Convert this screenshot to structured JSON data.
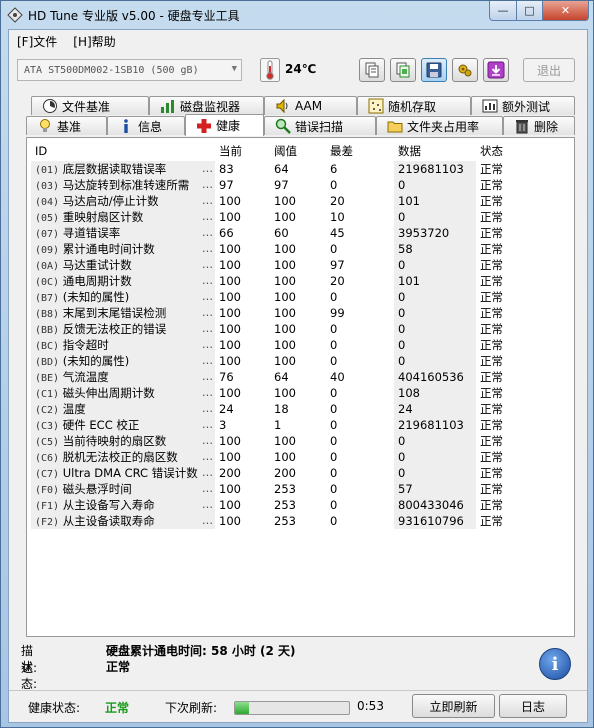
{
  "window": {
    "title": "HD Tune 专业版 v5.00 - 硬盘专业工具",
    "min_label": "—",
    "max_label": "□",
    "close_label": "✕"
  },
  "menu": [
    {
      "label": "[F]文件"
    },
    {
      "label": "[H]帮助"
    }
  ],
  "toolbar": {
    "drive": "ATA    ST500DM002-1SB10 (500 gB)",
    "temperature": "24℃",
    "exit_label": "退出",
    "icons": [
      "copy-info-icon",
      "copy-screen-icon",
      "save-icon",
      "options-icon",
      "download-icon"
    ]
  },
  "tabs_top": [
    {
      "label": "文件基准",
      "icon": "file-benchmark-icon"
    },
    {
      "label": "磁盘监视器",
      "icon": "disk-monitor-icon"
    },
    {
      "label": "AAM",
      "icon": "speaker-icon"
    },
    {
      "label": "随机存取",
      "icon": "random-access-icon"
    },
    {
      "label": "额外测试",
      "icon": "extra-tests-icon"
    }
  ],
  "tabs_bottom": [
    {
      "label": "基准",
      "icon": "benchmark-icon"
    },
    {
      "label": "信息",
      "icon": "info-icon"
    },
    {
      "label": "健康",
      "icon": "health-cross-icon",
      "selected": true
    },
    {
      "label": "错误扫描",
      "icon": "magnifier-icon"
    },
    {
      "label": "文件夹占用率",
      "icon": "folder-icon"
    },
    {
      "label": "删除",
      "icon": "trash-icon"
    }
  ],
  "health_table": {
    "columns": [
      "ID",
      "当前",
      "阈值",
      "最差",
      "数据",
      "状态"
    ],
    "rows": [
      {
        "code": "(01)",
        "name": "底层数据读取错误率",
        "cur": "83",
        "thr": "64",
        "worst": "6",
        "data": "219681103",
        "status": "正常"
      },
      {
        "code": "(03)",
        "name": "马达旋转到标准转速所需",
        "cur": "97",
        "thr": "97",
        "worst": "0",
        "data": "0",
        "status": "正常"
      },
      {
        "code": "(04)",
        "name": "马达启动/停止计数",
        "cur": "100",
        "thr": "100",
        "worst": "20",
        "data": "101",
        "status": "正常"
      },
      {
        "code": "(05)",
        "name": "重映射扇区计数",
        "cur": "100",
        "thr": "100",
        "worst": "10",
        "data": "0",
        "status": "正常"
      },
      {
        "code": "(07)",
        "name": "寻道错误率",
        "cur": "66",
        "thr": "60",
        "worst": "45",
        "data": "3953720",
        "status": "正常"
      },
      {
        "code": "(09)",
        "name": "累计通电时间计数",
        "cur": "100",
        "thr": "100",
        "worst": "0",
        "data": "58",
        "status": "正常"
      },
      {
        "code": "(0A)",
        "name": "马达重试计数",
        "cur": "100",
        "thr": "100",
        "worst": "97",
        "data": "0",
        "status": "正常"
      },
      {
        "code": "(0C)",
        "name": "通电周期计数",
        "cur": "100",
        "thr": "100",
        "worst": "20",
        "data": "101",
        "status": "正常"
      },
      {
        "code": "(B7)",
        "name": "(未知的属性)",
        "cur": "100",
        "thr": "100",
        "worst": "0",
        "data": "0",
        "status": "正常"
      },
      {
        "code": "(B8)",
        "name": "末尾到末尾错误检测",
        "cur": "100",
        "thr": "100",
        "worst": "99",
        "data": "0",
        "status": "正常"
      },
      {
        "code": "(BB)",
        "name": "反馈无法校正的错误",
        "cur": "100",
        "thr": "100",
        "worst": "0",
        "data": "0",
        "status": "正常"
      },
      {
        "code": "(BC)",
        "name": "指令超时",
        "cur": "100",
        "thr": "100",
        "worst": "0",
        "data": "0",
        "status": "正常"
      },
      {
        "code": "(BD)",
        "name": "(未知的属性)",
        "cur": "100",
        "thr": "100",
        "worst": "0",
        "data": "0",
        "status": "正常"
      },
      {
        "code": "(BE)",
        "name": "气流温度",
        "cur": "76",
        "thr": "64",
        "worst": "40",
        "data": "404160536",
        "status": "正常"
      },
      {
        "code": "(C1)",
        "name": "磁头伸出周期计数",
        "cur": "100",
        "thr": "100",
        "worst": "0",
        "data": "108",
        "status": "正常"
      },
      {
        "code": "(C2)",
        "name": "温度",
        "cur": "24",
        "thr": "18",
        "worst": "0",
        "data": "24",
        "status": "正常"
      },
      {
        "code": "(C3)",
        "name": "硬件 ECC 校正",
        "cur": "3",
        "thr": "1",
        "worst": "0",
        "data": "219681103",
        "status": "正常"
      },
      {
        "code": "(C5)",
        "name": "当前待映射的扇区数",
        "cur": "100",
        "thr": "100",
        "worst": "0",
        "data": "0",
        "status": "正常"
      },
      {
        "code": "(C6)",
        "name": "脱机无法校正的扇区数",
        "cur": "100",
        "thr": "100",
        "worst": "0",
        "data": "0",
        "status": "正常"
      },
      {
        "code": "(C7)",
        "name": "Ultra DMA CRC 错误计数",
        "cur": "200",
        "thr": "200",
        "worst": "0",
        "data": "0",
        "status": "正常"
      },
      {
        "code": "(F0)",
        "name": "磁头悬浮时间",
        "cur": "100",
        "thr": "253",
        "worst": "0",
        "data": "57",
        "status": "正常"
      },
      {
        "code": "(F1)",
        "name": "从主设备写入寿命",
        "cur": "100",
        "thr": "253",
        "worst": "0",
        "data": "800433046",
        "status": "正常"
      },
      {
        "code": "(F2)",
        "name": "从主设备读取寿命",
        "cur": "100",
        "thr": "253",
        "worst": "0",
        "data": "931610796",
        "status": "正常"
      }
    ]
  },
  "description": {
    "desc_label": "描述:",
    "desc_value": "硬盘累计通电时间: 58 小时 (2 天)",
    "state_label": "状态:",
    "state_value": "正常"
  },
  "status_bar": {
    "health_label": "健康状态:",
    "health_value": "正常",
    "next_refresh_label": "下次刷新:",
    "progress_fraction": 0.12,
    "time": "0:53",
    "refresh_button": "立即刷新",
    "log_button": "日志"
  },
  "colors": {
    "ok_green": "#1a9a1a",
    "accent_blue": "#3c7fb1"
  }
}
